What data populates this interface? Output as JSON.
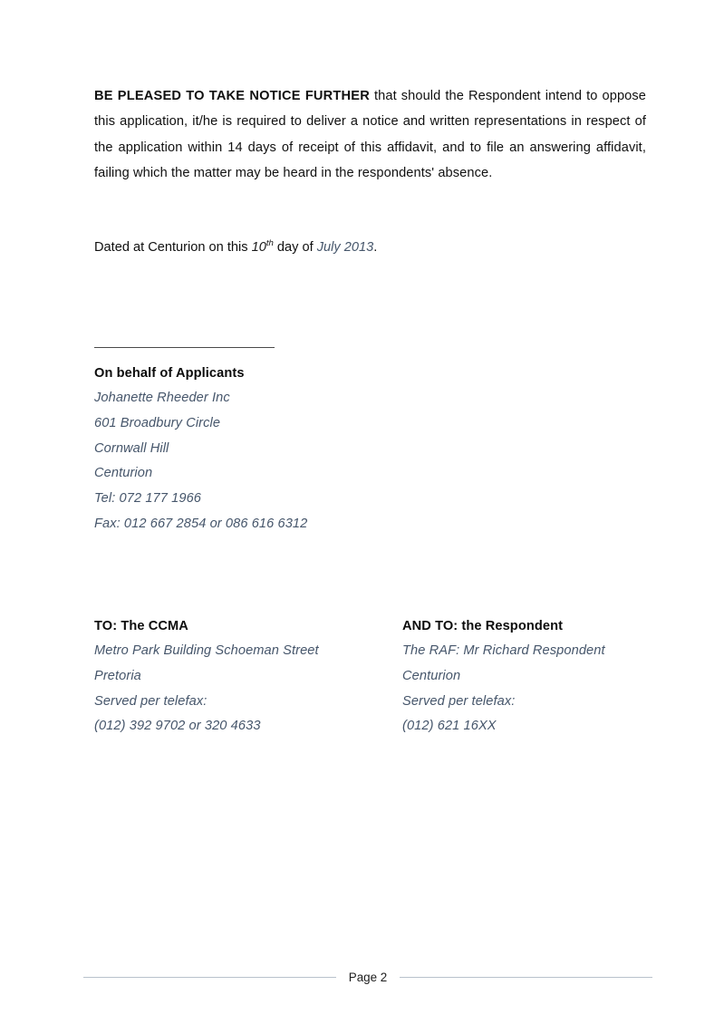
{
  "document": {
    "body_paragraph": {
      "lead_bold": "BE PLEASED TO TAKE NOTICE FURTHER",
      "rest": " that should the Respondent intend to oppose this application, it/he is required to deliver a notice and written representations in respect of the application within 14 days of receipt of this affidavit, and to file an answering affidavit, failing which the matter may be heard in the respondents' absence."
    },
    "dated_line": {
      "prefix": "Dated at Centurion on this ",
      "day_number": "10",
      "day_ordinal_suffix": "th",
      "middle": " day of ",
      "month_year": "July 2013",
      "suffix": "."
    },
    "signature_block": {
      "heading": "On behalf of Applicants",
      "lines": [
        "Johanette Rheeder Inc",
        "601 Broadbury Circle",
        "Cornwall Hill",
        "Centurion",
        "Tel: 072 177 1966",
        "Fax: 012 667 2854 or 086 616 6312"
      ]
    },
    "service_columns": [
      {
        "heading": "TO: The CCMA",
        "lines": [
          "Metro Park Building Schoeman Street",
          "Pretoria",
          "Served per telefax:",
          "(012) 392 9702 or 320 4633"
        ]
      },
      {
        "heading": "AND TO: the Respondent",
        "lines": [
          "The RAF: Mr Richard Respondent",
          "Centurion",
          "Served per telefax:",
          "(012) 621 16XX"
        ]
      }
    ],
    "footer": {
      "page_label": "Page 2"
    },
    "colors": {
      "body_text": "#101010",
      "italic_accent": "#46566b",
      "signature_rule": "#4a4a4a",
      "footer_rule": "#b8c2cc",
      "page_background": "#ffffff"
    }
  }
}
